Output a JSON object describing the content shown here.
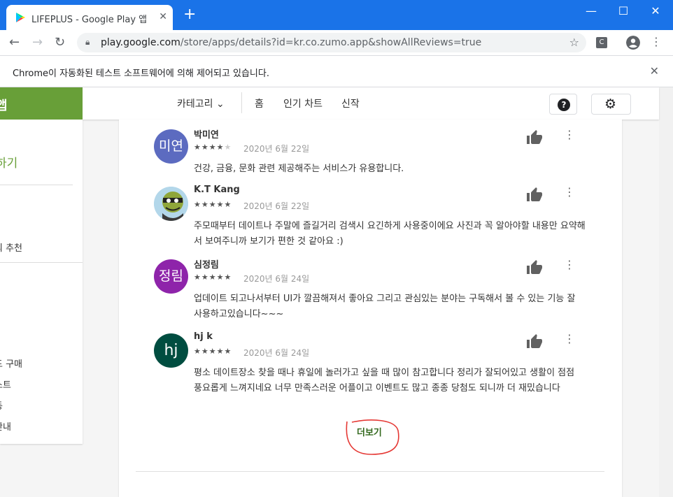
{
  "browser": {
    "tab_title": "LIFEPLUS - Google Play 앱",
    "url_host": "play.google.com",
    "url_path": "/store/apps/details?id=kr.co.zumo.app&showAllReviews=true",
    "infobar_message": "Chrome이 자동화된 테스트 소프트웨어에 의해 제어되고 있습니다.",
    "extension_label": "C"
  },
  "header": {
    "left_label": "앱",
    "category": "카테고리",
    "links": [
      "홈",
      "인기 차트",
      "신작"
    ]
  },
  "sidebar": {
    "green_label": "하기",
    "items": [
      "의 추천",
      "드 구매",
      "스트",
      "동",
      "안내"
    ]
  },
  "reviews": [
    {
      "name": "박미연",
      "avatar_text": "미연",
      "avatar_color": "#5c6bc0",
      "rating": 4,
      "date": "2020년 6월 22일",
      "text": "건강, 금융, 문화 관련 제공해주는 서비스가 유용합니다."
    },
    {
      "name": "K.T Kang",
      "avatar_text": "",
      "avatar_color": "#a8d0e6",
      "rating": 5,
      "date": "2020년 6월 22일",
      "text": "주모때부터 데이트나 주말에 즐길거리 검색시 요긴하게 사용중이에요 사진과 꼭 알아야할 내용만 요약해서 보여주니까 보기가 편한 것 같아요 :)"
    },
    {
      "name": "심정림",
      "avatar_text": "정림",
      "avatar_color": "#8e24aa",
      "rating": 5,
      "date": "2020년 6월 24일",
      "text": "업데이트 되고나서부터 UI가 깔끔해져서 좋아요 그리고 관심있는 분야는 구독해서 볼 수 있는 기능 잘 사용하고있습니다~~~"
    },
    {
      "name": "hj k",
      "avatar_text": "hj",
      "avatar_color": "#004d40",
      "rating": 5,
      "date": "2020년 6월 24일",
      "text": "평소 데이트장소 찾을 때나 휴일에 놀러가고 싶을 때 많이 참고합니다 정리가 잘되어있고 생활이 점점 풍요롭게 느껴지네요 너무 만족스러운 어플이고 이벤트도 많고 종종 당첨도 되니까 더 재밌습니다"
    }
  ],
  "show_more_label": "더보기",
  "colors": {
    "accent_green": "#689f38",
    "chrome_blue": "#1a73e8",
    "annotation_red": "#e53935"
  }
}
